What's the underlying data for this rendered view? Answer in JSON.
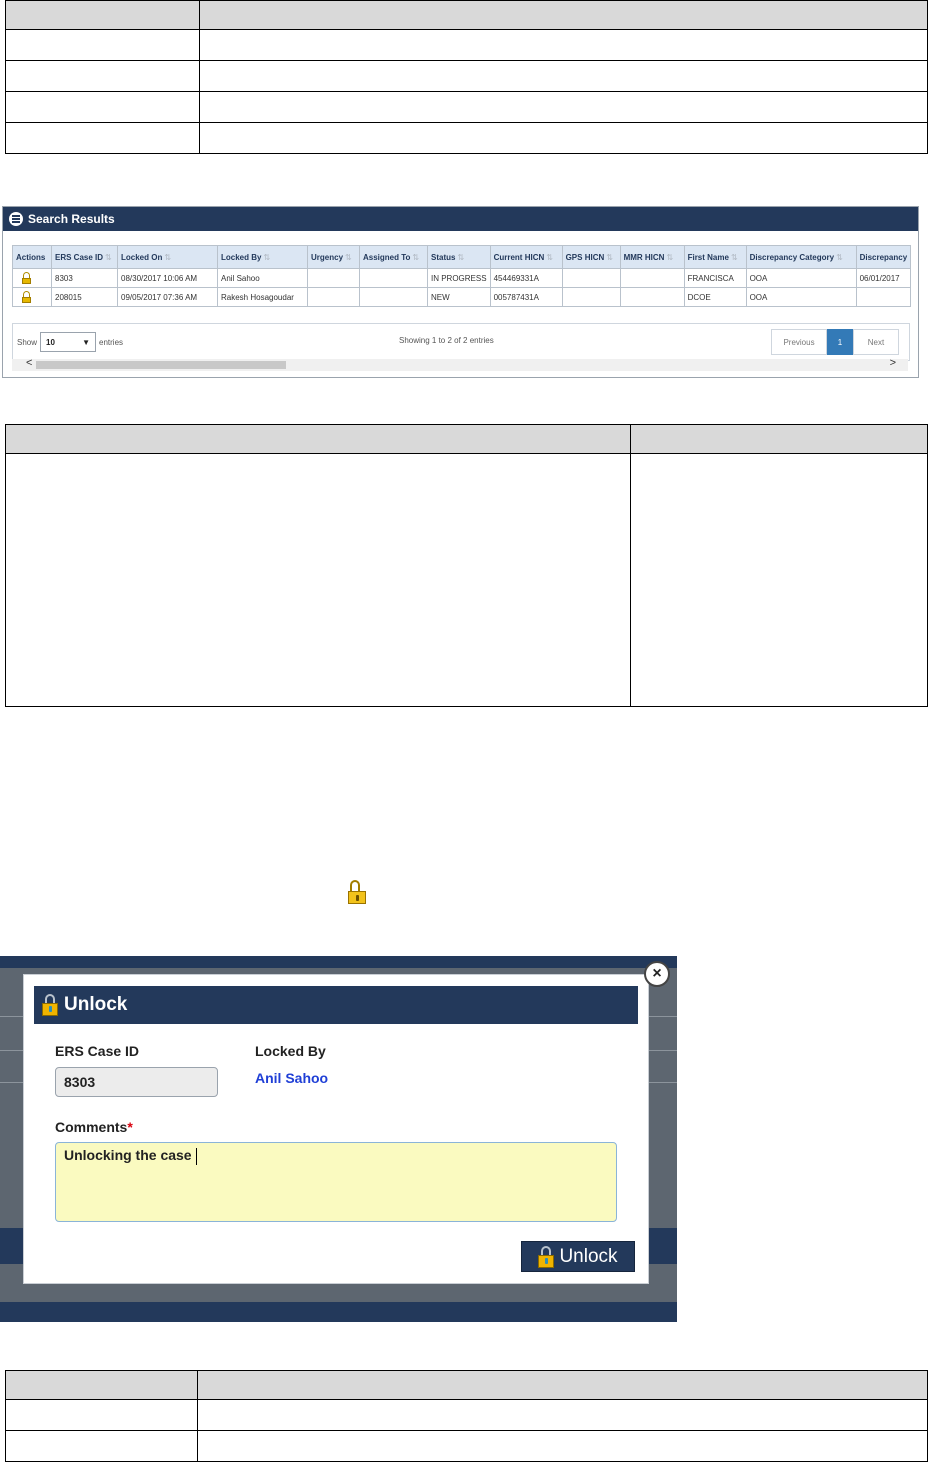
{
  "search_results": {
    "title": "Search Results",
    "columns": [
      "Actions",
      "ERS Case ID",
      "Locked On",
      "Locked By",
      "Urgency",
      "Assigned To",
      "Status",
      "Current HICN",
      "GPS HICN",
      "MMR HICN",
      "First Name",
      "Discrepancy Category",
      "Discrepancy"
    ],
    "rows": [
      [
        "",
        "8303",
        "08/30/2017 10:06 AM",
        "Anil Sahoo",
        "",
        "",
        "IN PROGRESS",
        "454469331A",
        "",
        "",
        "FRANCISCA",
        "OOA",
        "06/01/2017"
      ],
      [
        "",
        "208015",
        "09/05/2017 07:36 AM",
        "Rakesh Hosagoudar",
        "",
        "",
        "NEW",
        "005787431A",
        "",
        "",
        "DCOE",
        "OOA",
        ""
      ]
    ],
    "show_label": "Show",
    "page_size": "10",
    "entries_label": "entries",
    "info": "Showing 1 to 2 of 2 entries",
    "prev_label": "Previous",
    "current_page": "1",
    "next_label": "Next"
  },
  "unlock_dialog": {
    "title": "Unlock",
    "case_id_label": "ERS Case ID",
    "case_id_value": "8303",
    "locked_by_label": "Locked By",
    "locked_by_value": "Anil Sahoo",
    "comments_label": "Comments",
    "required_mark": "*",
    "comments_value": "Unlocking the case",
    "unlock_button": "Unlock",
    "close_symbol": "×"
  },
  "colors": {
    "header_navy": "#23395b",
    "link_blue": "#1f3fd6",
    "comment_bg": "#fafac0",
    "lock_gold": "#f2c21b"
  },
  "icons": [
    "list-icon",
    "unlock-icon",
    "close-icon",
    "chevron-down-icon"
  ]
}
